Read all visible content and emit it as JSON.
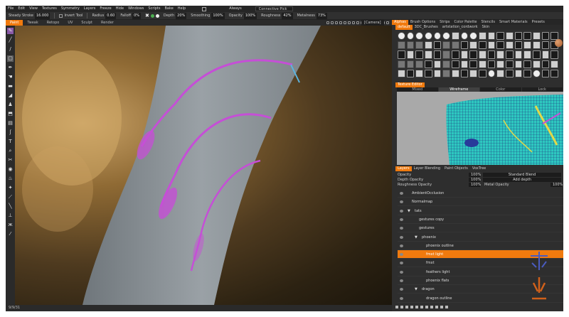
{
  "menu": [
    "File",
    "Edit",
    "View",
    "Textures",
    "Symmetry",
    "Layers",
    "Freeze",
    "Hide",
    "Windows",
    "Scripts",
    "Bake",
    "Help"
  ],
  "menu_extra": {
    "always": "Always",
    "connective": "Connective Pick"
  },
  "toolopts": {
    "steady_label": "Steady Stroke",
    "steady_val": "16.000",
    "invert": "Invert Tool",
    "radius_label": "Radius",
    "radius_val": "0.60",
    "falloff_label": "Falloff",
    "falloff_val": "0%",
    "depth_label": "Depth",
    "depth_val": "20%",
    "smoothing_label": "Smoothing",
    "smoothing_val": "100%",
    "opacity_label": "Opacity",
    "opacity_val": "100%",
    "roughness_label": "Roughness",
    "roughness_val": "42%",
    "metalness_label": "Metalness",
    "metalness_val": "73%"
  },
  "modetabs": [
    "Paint",
    "Tweak",
    "Retopo",
    "UV",
    "Sculpt",
    "Render"
  ],
  "camera": "[Camera]",
  "status": "9/9/31",
  "right_tabs_top": [
    "Alphas",
    "Brush Options",
    "Strips",
    "Color Palette",
    "Stencils",
    "Smart Materials",
    "Presets"
  ],
  "right_tabs_sub": [
    "default",
    "3DC_Brushes",
    "artstation_cordwork",
    "Skin"
  ],
  "texture_editor_tabs": [
    "Texture Editor"
  ],
  "texture_modes": [
    "Mixed",
    "Wireframe",
    "Color",
    "Lock"
  ],
  "layers_tabs": [
    "Layers",
    "Layer Blending",
    "Paint Objects",
    "VoxTree"
  ],
  "layer_props": [
    {
      "label": "Opacity",
      "val": "100%",
      "val2": "Standard Blend"
    },
    {
      "label": "Depth Opacity",
      "val": "100%",
      "val2": "Add depth"
    },
    {
      "label": "Roughness Opacity",
      "val": "100%",
      "label2": "Metal Opacity",
      "val3": "100%"
    }
  ],
  "layers": [
    {
      "name": "AmbientOcclusion",
      "indent": 0,
      "group": false,
      "selected": false
    },
    {
      "name": "Normalmap",
      "indent": 0,
      "group": false,
      "selected": false
    },
    {
      "name": "tats",
      "indent": 0,
      "group": true,
      "selected": false
    },
    {
      "name": "gestures copy",
      "indent": 1,
      "group": false,
      "selected": false
    },
    {
      "name": "gestures",
      "indent": 1,
      "group": false,
      "selected": false
    },
    {
      "name": "phoenix",
      "indent": 1,
      "group": true,
      "selected": false
    },
    {
      "name": "phoenix outline",
      "indent": 2,
      "group": false,
      "selected": false
    },
    {
      "name": "fmxt light",
      "indent": 2,
      "group": false,
      "selected": true
    },
    {
      "name": "fmxt",
      "indent": 2,
      "group": false,
      "selected": false
    },
    {
      "name": "feathers light",
      "indent": 2,
      "group": false,
      "selected": false
    },
    {
      "name": "phoenix flats",
      "indent": 2,
      "group": false,
      "selected": false
    },
    {
      "name": "dragon",
      "indent": 1,
      "group": true,
      "selected": false
    },
    {
      "name": "dragon outline",
      "indent": 2,
      "group": false,
      "selected": false
    }
  ],
  "colors": {
    "accent": "#f07a0e",
    "stroke": "#c54fd6",
    "skin": "#8d9499"
  }
}
